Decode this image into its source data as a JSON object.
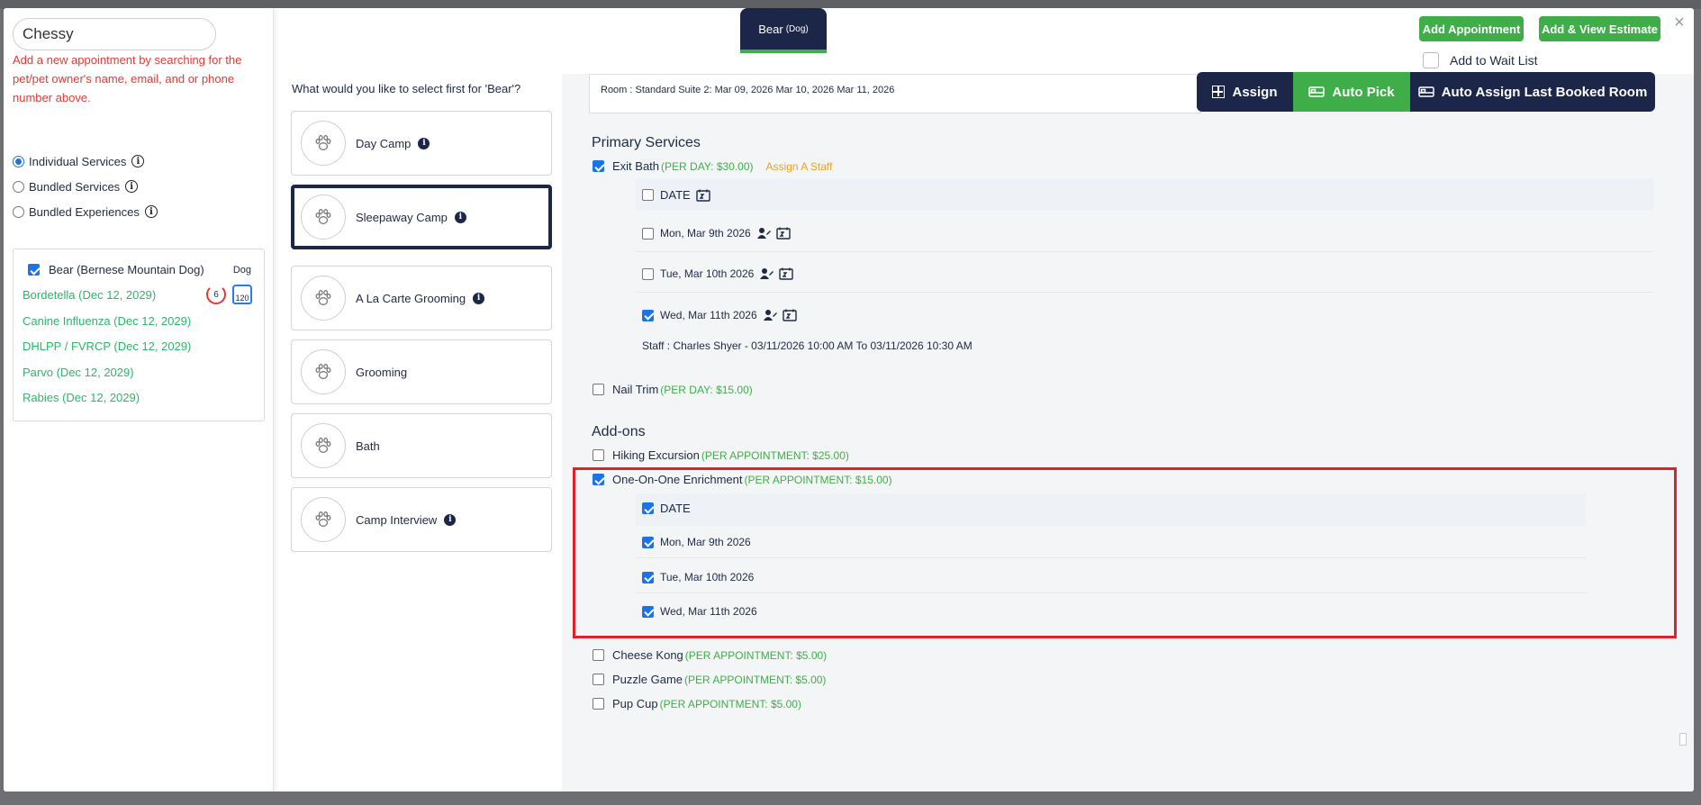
{
  "search": {
    "value": "Chessy"
  },
  "hint": "Add a new appointment by searching for the pet/pet owner's name, email, and or phone number above.",
  "service_types": [
    {
      "label": "Individual Services",
      "selected": true
    },
    {
      "label": "Bundled Services",
      "selected": false
    },
    {
      "label": "Bundled Experiences",
      "selected": false
    }
  ],
  "pet_card": {
    "name": "Bear (Bernese Mountain Dog)",
    "type": "Dog",
    "vaccine_badge": "6",
    "weight_badge": "120",
    "vaccinations": [
      "Bordetella (Dec 12, 2029)",
      "Canine Influenza (Dec 12, 2029)",
      "DHLPP / FVRCP (Dec 12, 2029)",
      "Parvo (Dec 12, 2029)",
      "Rabies (Dec 12, 2029)"
    ]
  },
  "question": "What would you like to select first for 'Bear'?",
  "services": [
    {
      "label": "Day Camp",
      "info": true,
      "selected": false
    },
    {
      "label": "Sleepaway Camp",
      "info": true,
      "selected": true
    },
    {
      "label": "A La Carte Grooming",
      "info": true,
      "selected": false
    },
    {
      "label": "Grooming",
      "info": false,
      "selected": false
    },
    {
      "label": "Bath",
      "info": false,
      "selected": false
    },
    {
      "label": "Camp Interview",
      "info": true,
      "selected": false
    }
  ],
  "pet_tab": {
    "name": "Bear",
    "type": "(Dog)"
  },
  "header": {
    "add_appointment": "Add Appointment",
    "add_view_estimate": "Add & View Estimate",
    "wait_list": "Add to Wait List",
    "close": "×"
  },
  "room": {
    "text": "Room :  Standard Suite 2: Mar 09, 2026 Mar 10, 2026 Mar 11, 2026",
    "assign": "Assign",
    "auto_pick": "Auto Pick",
    "auto_assign_last": "Auto Assign Last Booked Room"
  },
  "primary": {
    "title": "Primary Services",
    "exit_bath": {
      "label": "Exit Bath",
      "price": "(PER DAY: $30.00)",
      "assign_staff": "Assign A Staff",
      "checked": true
    },
    "date_header": "DATE",
    "dates": [
      {
        "label": "Mon, Mar 9th 2026",
        "checked": false
      },
      {
        "label": "Tue, Mar 10th 2026",
        "checked": false
      },
      {
        "label": "Wed, Mar 11th 2026",
        "checked": true
      }
    ],
    "staff": "Staff :  Charles Shyer  -  03/11/2026 10:00 AM   To   03/11/2026 10:30 AM",
    "nail_trim": {
      "label": "Nail Trim",
      "price": "(PER DAY: $15.00)",
      "checked": false
    }
  },
  "addons": {
    "title": "Add-ons",
    "hiking": {
      "label": "Hiking Excursion",
      "price": "(PER APPOINTMENT: $25.00)",
      "checked": false
    },
    "enrichment": {
      "label": "One-On-One Enrichment",
      "price": "(PER APPOINTMENT: $15.00)",
      "checked": true
    },
    "date_header": "DATE",
    "dates": [
      {
        "label": "Mon, Mar 9th 2026",
        "checked": true
      },
      {
        "label": "Tue, Mar 10th 2026",
        "checked": true
      },
      {
        "label": "Wed, Mar 11th 2026",
        "checked": true
      }
    ],
    "cheese_kong": {
      "label": "Cheese Kong",
      "price": "(PER APPOINTMENT: $5.00)",
      "checked": false
    },
    "puzzle_game": {
      "label": "Puzzle Game",
      "price": "(PER APPOINTMENT: $5.00)",
      "checked": false
    },
    "pup_cup": {
      "label": "Pup Cup",
      "price": "(PER APPOINTMENT: $5.00)",
      "checked": false
    }
  },
  "colors": {
    "navy": "#1b2649",
    "green": "#3fae49",
    "red": "#e53935",
    "vacc_green": "#2db56a",
    "orange": "#f0a21a"
  }
}
